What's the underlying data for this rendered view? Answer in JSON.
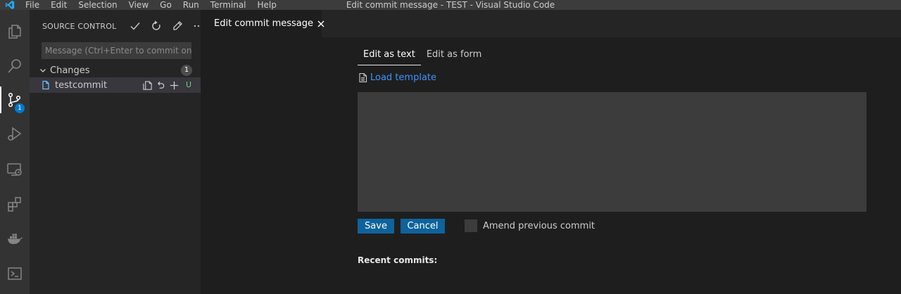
{
  "titlebar": {
    "menu": [
      "File",
      "Edit",
      "Selection",
      "View",
      "Go",
      "Run",
      "Terminal",
      "Help"
    ],
    "window_title": "Edit commit message - TEST - Visual Studio Code"
  },
  "activitybar": {
    "items": [
      "explorer-icon",
      "search-icon",
      "source-control-icon",
      "run-debug-icon",
      "remote-explorer-icon",
      "extensions-icon",
      "docker-icon",
      "terminal-icon"
    ],
    "scm_badge": "1"
  },
  "sidebar": {
    "title": "SOURCE CONTROL",
    "commit_placeholder": "Message (Ctrl+Enter to commit on '...",
    "changes_label": "Changes",
    "changes_count": "1",
    "files": [
      {
        "name": "testcommit",
        "status": "U"
      }
    ]
  },
  "tab": {
    "label": "Edit commit message"
  },
  "editor": {
    "tabs": [
      "Edit as text",
      "Edit as form"
    ],
    "load_template": "Load template",
    "message_value": "",
    "save_label": "Save",
    "cancel_label": "Cancel",
    "amend_label": "Amend previous commit",
    "amend_checked": false,
    "recent_commits_label": "Recent commits:"
  },
  "colors": {
    "accent": "#007acc",
    "button": "#0e639c",
    "link": "#3794ff",
    "untracked": "#73c991"
  }
}
